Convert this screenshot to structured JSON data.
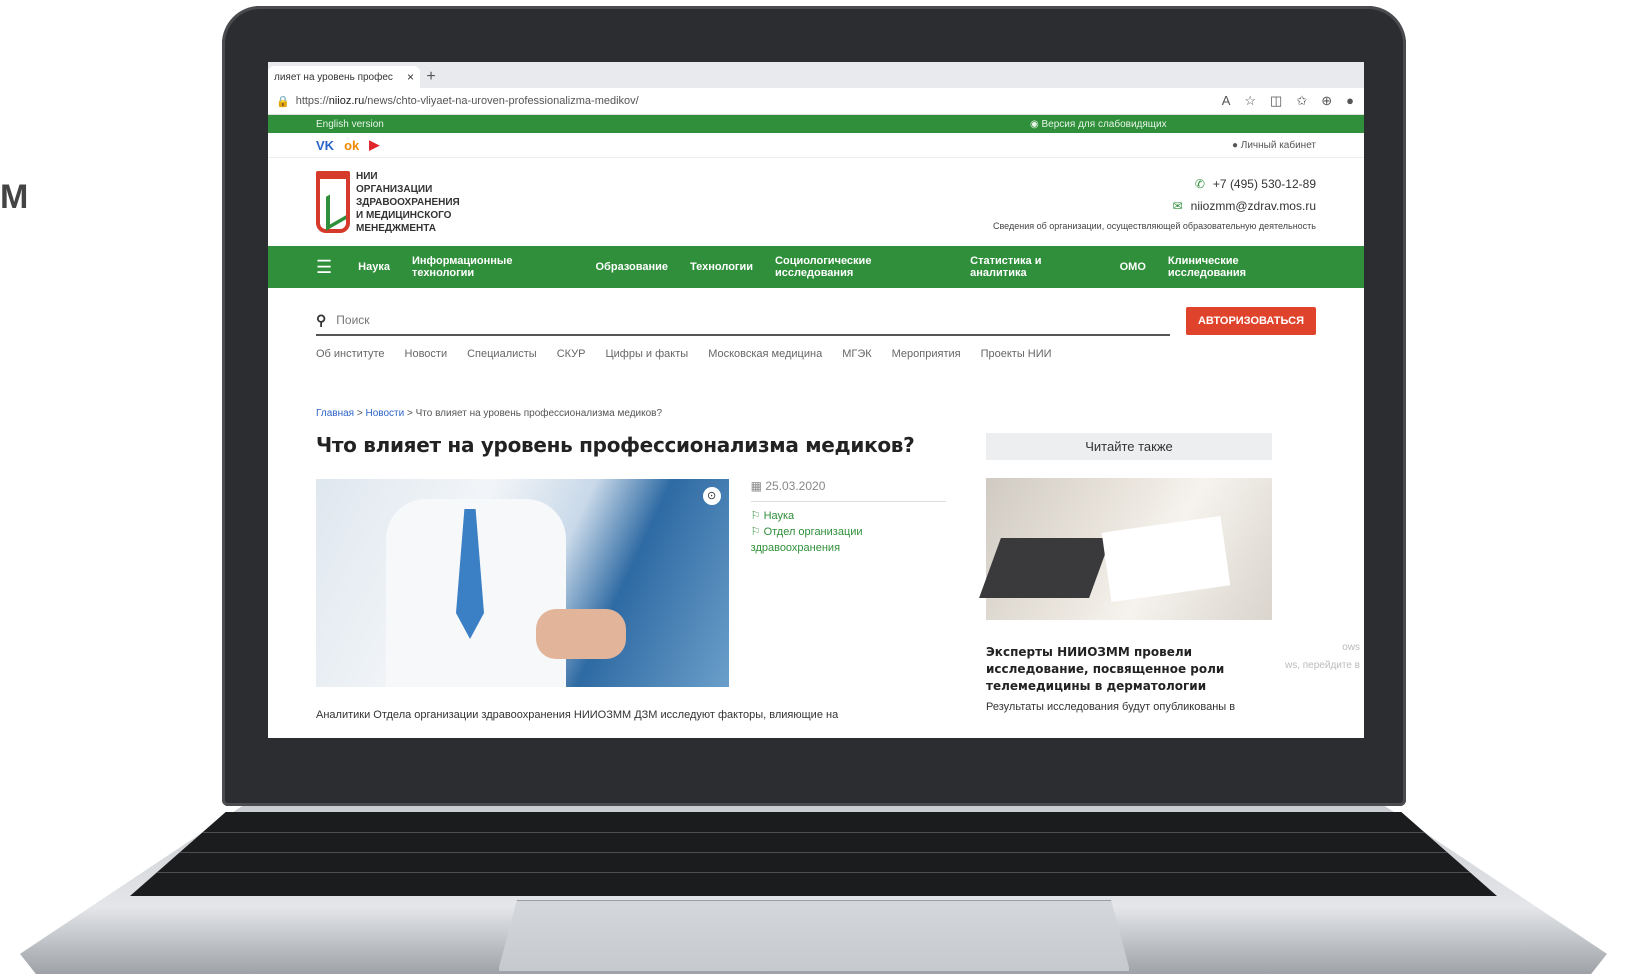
{
  "edge_text": "М",
  "browser": {
    "tab_title": "лияет на уровень профес",
    "tab_close": "×",
    "new_tab": "+",
    "url_prefix": "https://",
    "url_domain": "niioz.ru",
    "url_path": "/news/chto-vliyaet-na-uroven-professionalizma-medikov/"
  },
  "site": {
    "english_version": "English version",
    "low_vision": "Версия для слабовидящих",
    "cabinet": "Личный кабинет",
    "logo_lines": [
      "НИИ",
      "ОРГАНИЗАЦИИ",
      "ЗДРАВООХРАНЕНИЯ",
      "И МЕДИЦИНСКОГО",
      "МЕНЕДЖМЕНТА"
    ],
    "phone": "+7 (495) 530-12-89",
    "email": "niiozmm@zdrav.mos.ru",
    "edu_info": "Сведения об организации, осуществляющей образовательную деятельность",
    "main_nav": [
      "Наука",
      "Информационные технологии",
      "Образование",
      "Технологии",
      "Социологические исследования",
      "Статистика и аналитика",
      "ОМО",
      "Клинические исследования"
    ],
    "search_placeholder": "Поиск",
    "auth_button": "АВТОРИЗОВАТЬСЯ",
    "sub_nav": [
      "Об институте",
      "Новости",
      "Специалисты",
      "СКУР",
      "Цифры и факты",
      "Московская медицина",
      "МГЭК",
      "Мероприятия",
      "Проекты НИИ"
    ]
  },
  "breadcrumb": {
    "home": "Главная",
    "news": "Новости",
    "current": "Что влияет на уровень профессионализма медиков?"
  },
  "article": {
    "title": "Что влияет на уровень профессионализма медиков?",
    "date": "25.03.2020",
    "tags": [
      "Наука",
      "Отдел организации здравоохранения"
    ],
    "lead": "Аналитики Отдела организации здравоохранения НИИОЗММ ДЗМ исследуют факторы, влияющие на"
  },
  "sidebar": {
    "heading": "Читайте также",
    "title": "Эксперты НИИОЗММ провели исследование, посвященное роли телемедицины в дерматологии",
    "text": "Результаты исследования будут опубликованы в",
    "watermark_1": "ows",
    "watermark_2": "ws, перейдите в"
  }
}
